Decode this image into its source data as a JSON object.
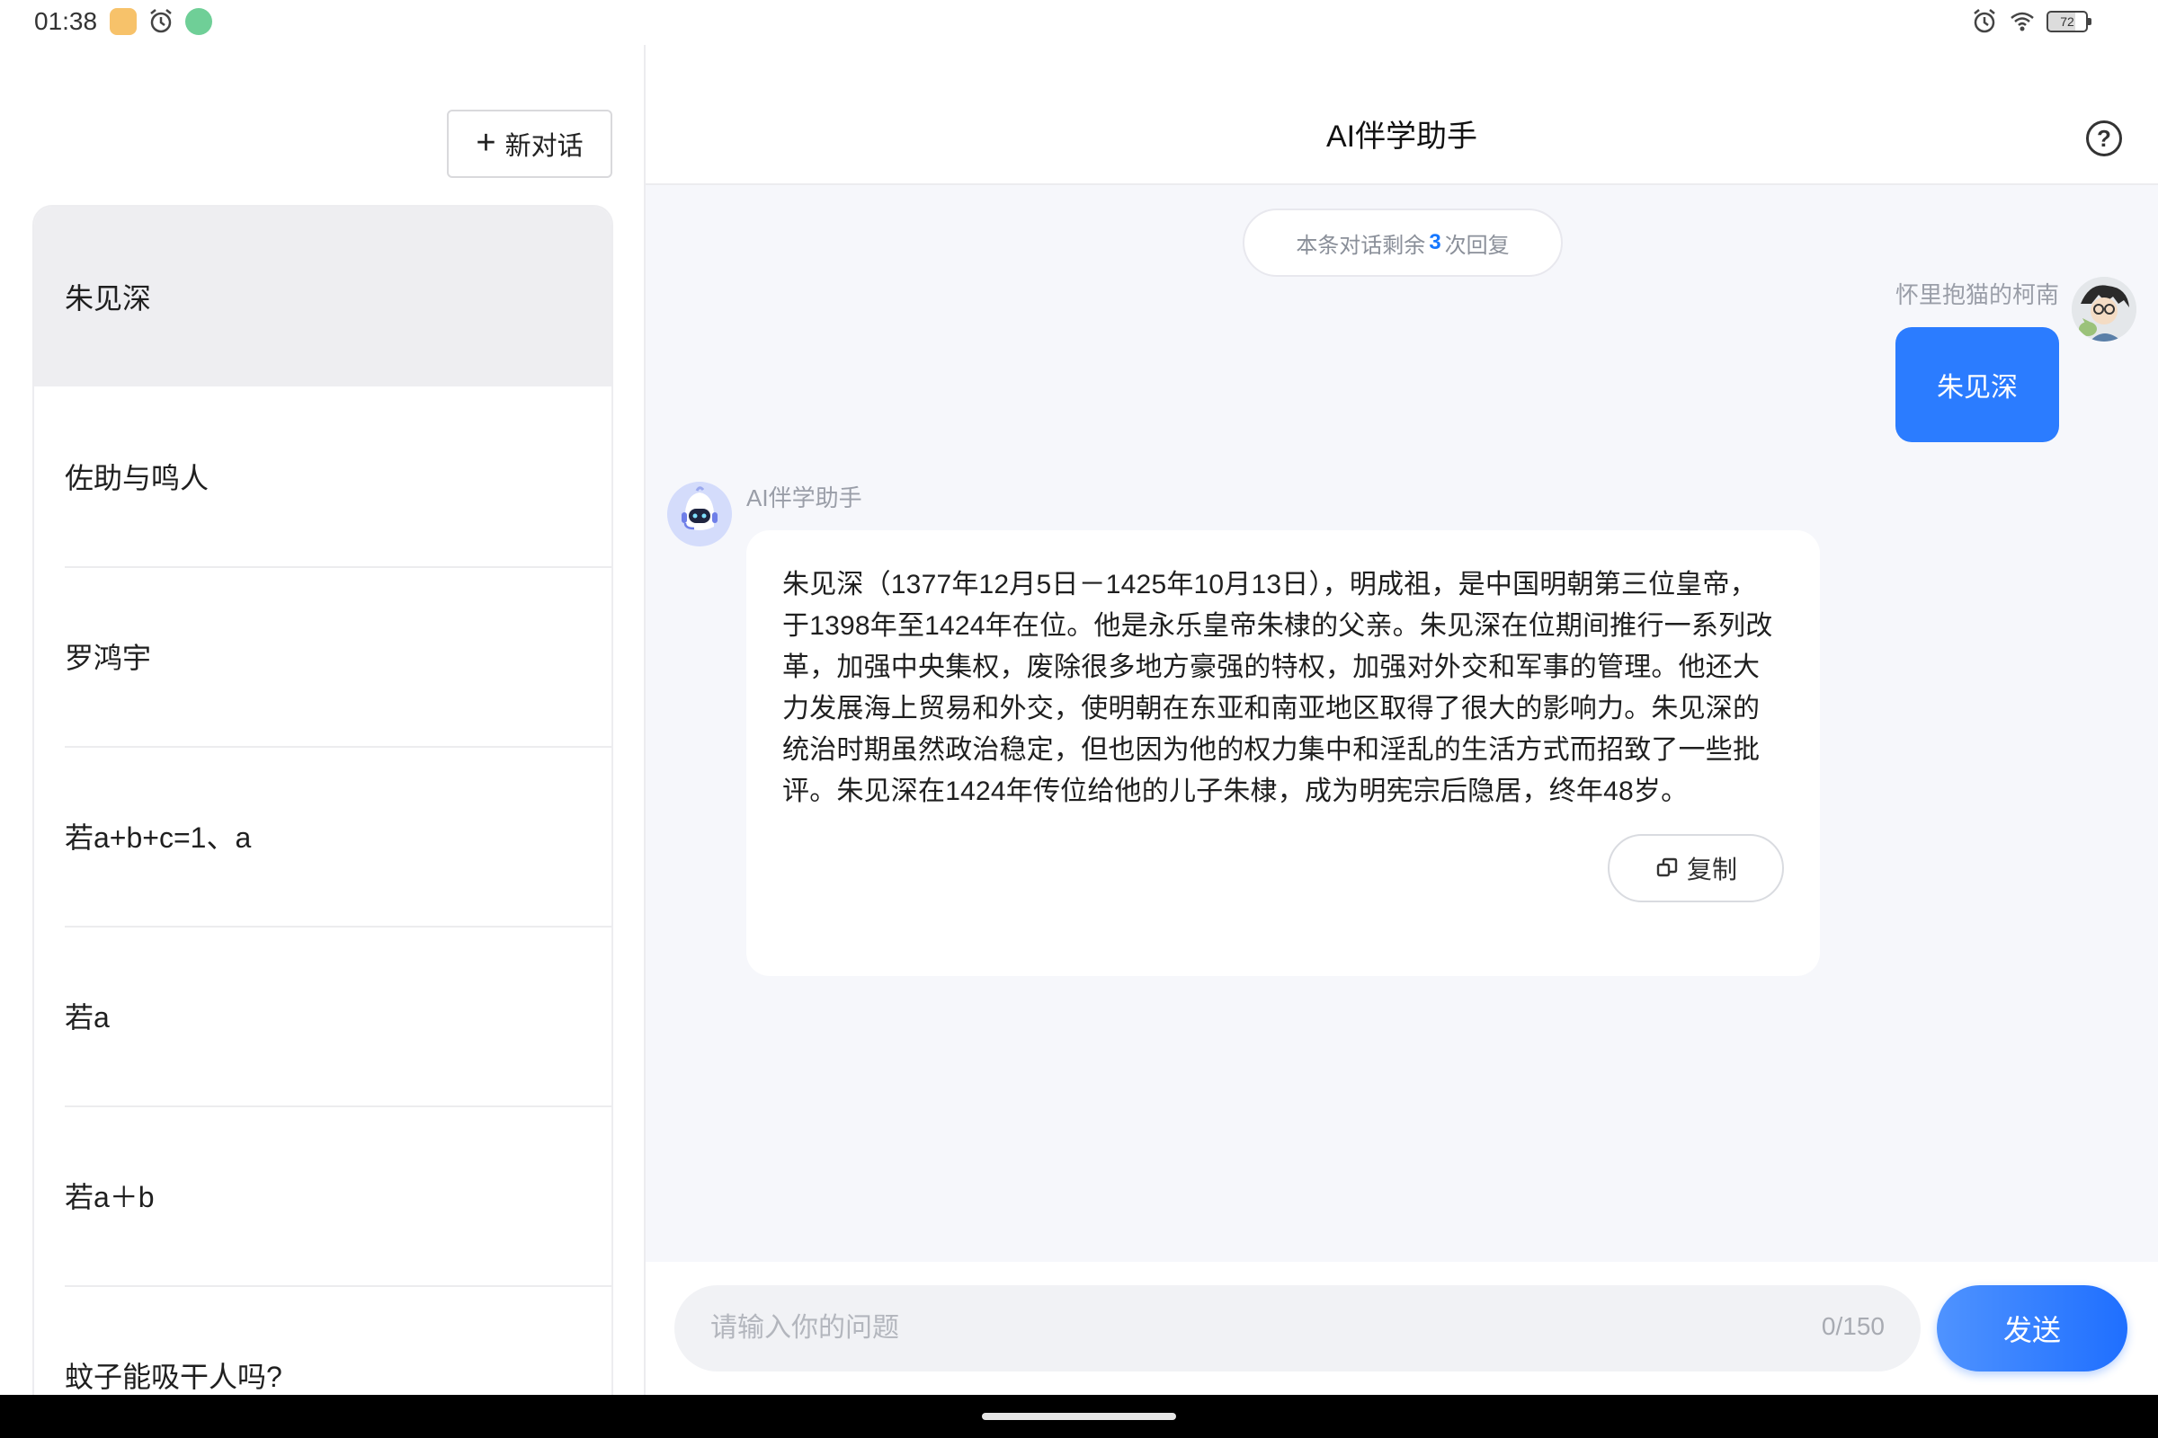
{
  "status_bar": {
    "time": "01:38",
    "battery": "72",
    "left_icons": [
      "app-icon",
      "alarm-icon",
      "app-icon"
    ],
    "right_icons": [
      "alarm-icon",
      "wifi-icon",
      "battery-icon"
    ]
  },
  "sidebar": {
    "new_chat_label": "新对话",
    "history": [
      {
        "label": "朱见深",
        "active": true
      },
      {
        "label": "佐助与鸣人",
        "active": false
      },
      {
        "label": "罗鸿宇",
        "active": false
      },
      {
        "label": "若a+b+c=1、a",
        "active": false
      },
      {
        "label": "若a",
        "active": false
      },
      {
        "label": "若a＋b",
        "active": false
      },
      {
        "label": "蚊子能吸干人吗?",
        "active": false
      }
    ]
  },
  "header": {
    "title": "AI伴学助手",
    "help_icon": "help-circle-icon"
  },
  "chat": {
    "remaining_prefix": "本条对话剩余",
    "remaining_count": "3",
    "remaining_suffix": "次回复",
    "user_name": "怀里抱猫的柯南",
    "user_message": "朱见深",
    "bot_name": "AI伴学助手",
    "bot_message": "朱见深（1377年12月5日－1425年10月13日），明成祖，是中国明朝第三位皇帝，于1398年至1424年在位。他是永乐皇帝朱棣的父亲。朱见深在位期间推行一系列改革，加强中央集权，废除很多地方豪强的特权，加强对外交和军事的管理。他还大力发展海上贸易和外交，使明朝在东亚和南亚地区取得了很大的影响力。朱见深的统治时期虽然政治稳定，但也因为他的权力集中和淫乱的生活方式而招致了一些批评。朱见深在1424年传位给他的儿子朱棣，成为明宪宗后隐居，终年48岁。",
    "copy_label": "复制"
  },
  "input": {
    "placeholder": "请输入你的问题",
    "value": "",
    "char_count": "0/150",
    "send_label": "发送"
  },
  "colors": {
    "accent": "#2b7cff",
    "panel_bg": "#f6f7fb",
    "active_item_bg": "#eeeef1"
  }
}
